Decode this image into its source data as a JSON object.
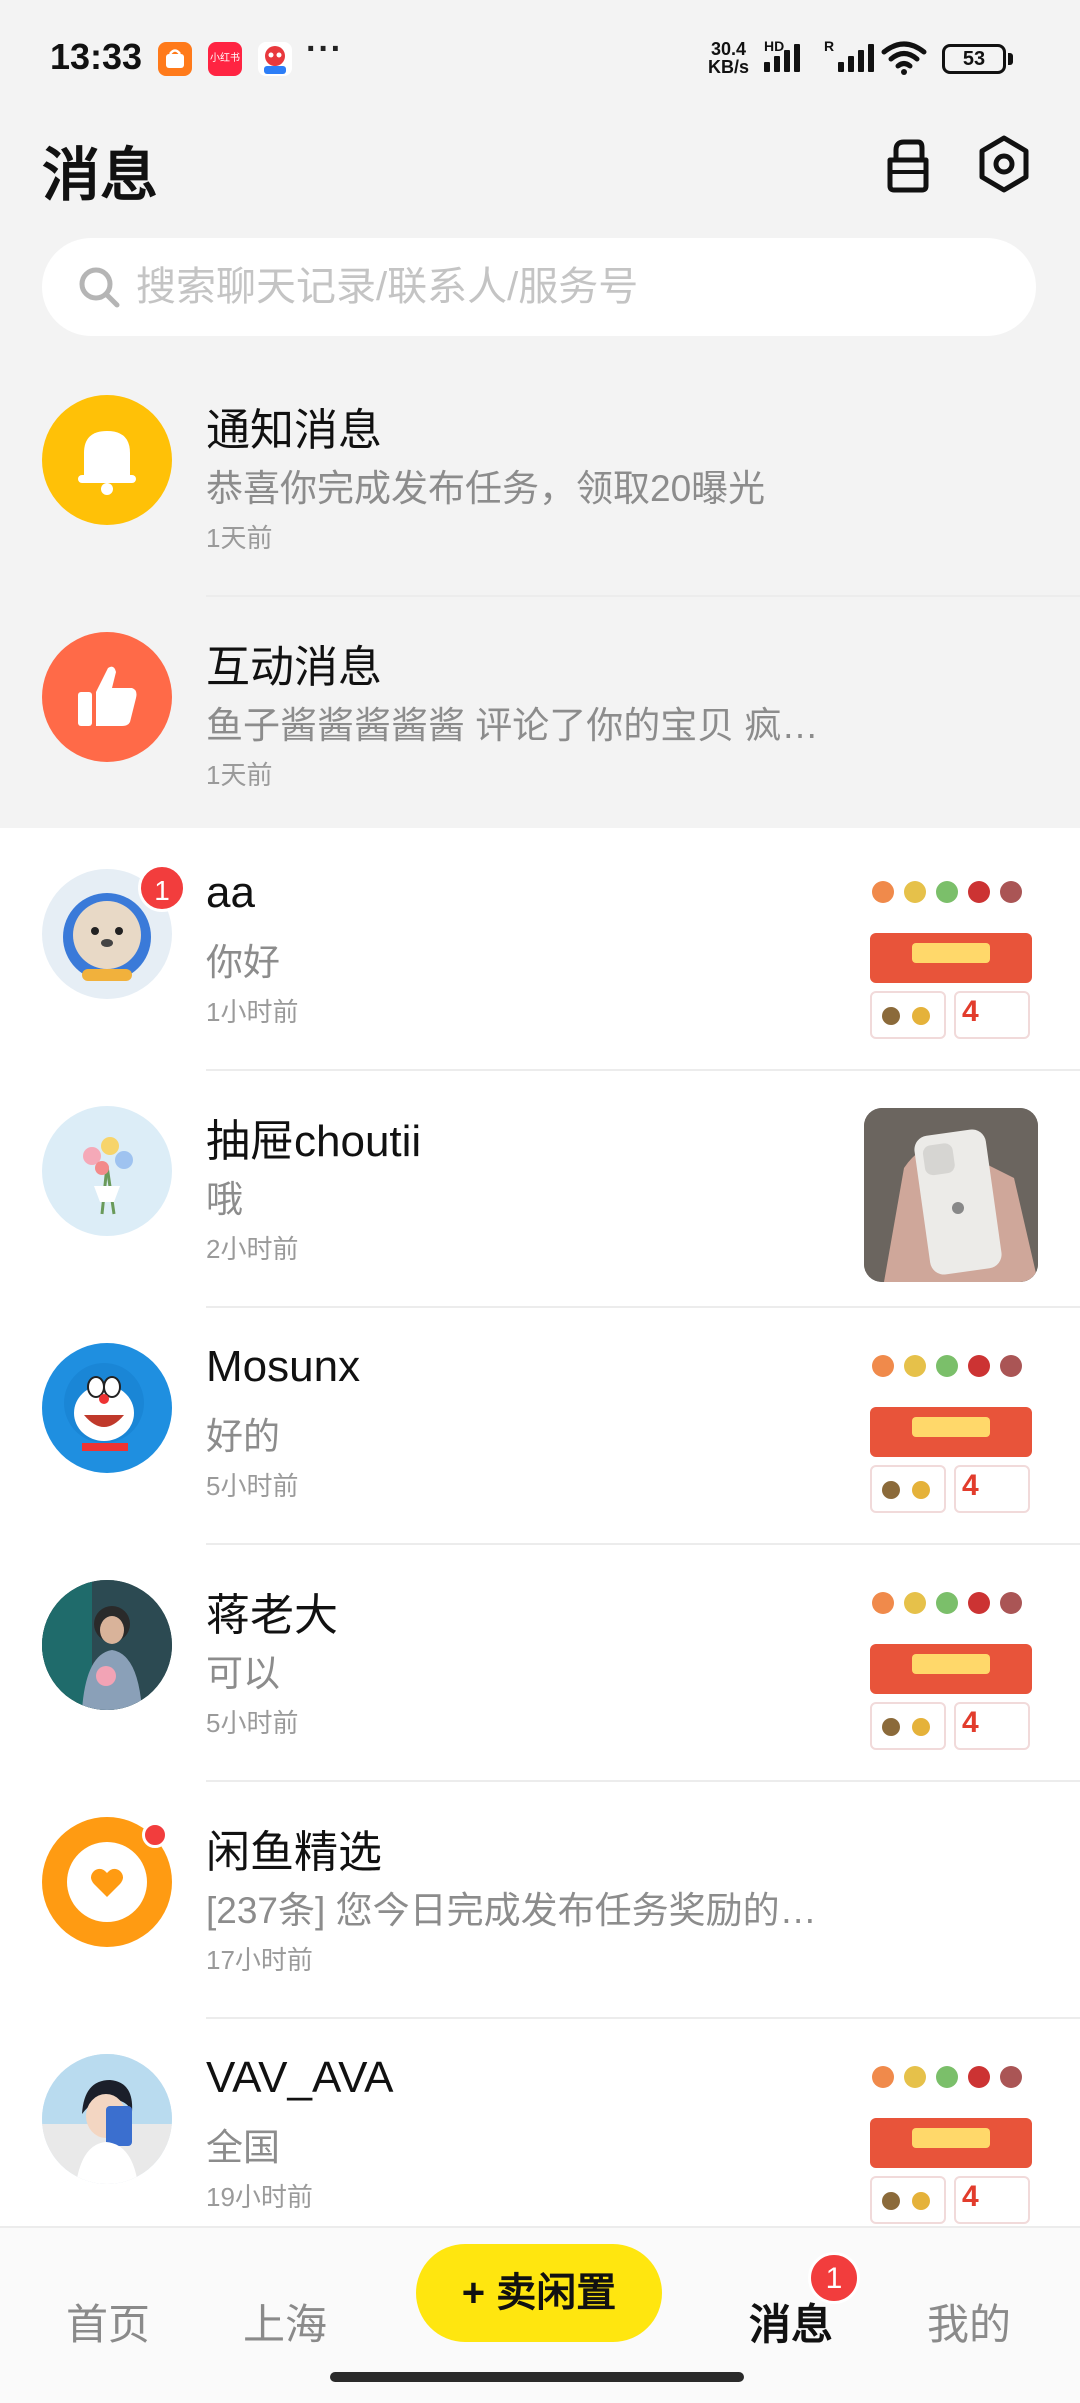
{
  "status_bar": {
    "time": "13:33",
    "notification_icons": [
      "taobao-app-icon",
      "xiaohongshu-app-icon",
      "game-app-icon"
    ],
    "xiaohongshu_label": "小红书",
    "more": "···",
    "net_speed_value": "30.4",
    "net_speed_unit": "KB/s",
    "hd_label": "HD",
    "roaming_label": "R",
    "battery": "53"
  },
  "header": {
    "title": "消息",
    "icons": [
      "shop-bag-icon",
      "settings-hexagon-icon"
    ]
  },
  "search": {
    "placeholder": "搜索聊天记录/联系人/服务号"
  },
  "system_messages": [
    {
      "name": "通知消息",
      "preview": "恭喜你完成发布任务，领取20曝光",
      "time": "1天前",
      "icon": "bell-icon",
      "color": "#ffc107"
    },
    {
      "name": "互动消息",
      "preview": "鱼子酱酱酱酱酱 评论了你的宝贝 疯…",
      "time": "1天前",
      "icon": "thumbs-up-icon",
      "color": "#ff6a48"
    }
  ],
  "chats": [
    {
      "name": "aa",
      "preview": "你好",
      "time": "1小时前",
      "unread": "1",
      "avatar": "astronaut-cat-avatar",
      "thumb": "promo"
    },
    {
      "name": "抽屉choutii",
      "preview": "哦",
      "time": "2小时前",
      "avatar": "flower-bouquet-avatar",
      "thumb": "phone-photo"
    },
    {
      "name": "Mosunx",
      "preview": "好的",
      "time": "5小时前",
      "avatar": "doraemon-avatar",
      "thumb": "promo"
    },
    {
      "name": "蒋老大",
      "preview": "可以",
      "time": "5小时前",
      "avatar": "photo-avatar",
      "thumb": "promo"
    },
    {
      "name": "闲鱼精选",
      "preview": "[237条] 您今日完成发布任务奖励的…",
      "time": "17小时前",
      "dot": true,
      "avatar": "xianyu-heart-avatar"
    },
    {
      "name": "VAV_AVA",
      "preview": "全国",
      "time": "19小时前",
      "avatar": "anime-boy-avatar",
      "thumb": "promo"
    }
  ],
  "bottom_nav": {
    "home": "首页",
    "city": "上海",
    "sell": "+ 卖闲置",
    "messages": "消息",
    "messages_badge": "1",
    "mine": "我的"
  },
  "colors": {
    "accent_yellow": "#ffe60f",
    "badge_red": "#f23d3d",
    "background_top": "#f3f3f3"
  }
}
